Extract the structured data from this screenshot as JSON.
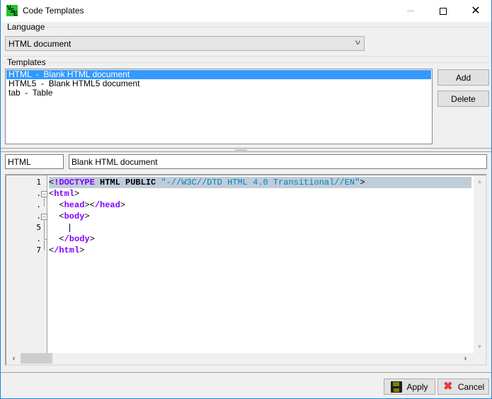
{
  "window": {
    "title": "Code Templates",
    "controls": {
      "minimize": "—",
      "maximize": "☐",
      "close": "✕"
    }
  },
  "language": {
    "group_label": "Language",
    "selected": "HTML document"
  },
  "templates": {
    "group_label": "Templates",
    "items": [
      {
        "label": "HTML  -  Blank HTML document",
        "selected": true
      },
      {
        "label": "HTML5  -  Blank HTML5 document",
        "selected": false
      },
      {
        "label": "tab  -  Table",
        "selected": false
      }
    ],
    "add_label": "Add",
    "delete_label": "Delete"
  },
  "splitter": {
    "grip": "▪▪▪▪▪▪▪▪"
  },
  "fields": {
    "name": "HTML",
    "description": "Blank HTML document"
  },
  "editor": {
    "line_numbers": [
      "1",
      ".",
      ".",
      ".",
      "5",
      ".",
      "7"
    ],
    "lines": [
      [
        {
          "t": "<",
          "c": "tag"
        },
        {
          "t": "!DOCTYPE",
          "c": "kw"
        },
        {
          "t": " ",
          "c": "tag"
        },
        {
          "t": "HTML",
          "c": "bold"
        },
        {
          "t": " ",
          "c": "tag"
        },
        {
          "t": "PUBLIC",
          "c": "bold"
        },
        {
          "t": " ",
          "c": "tag"
        },
        {
          "t": "\"-//W3C//DTD HTML 4.0 Transitional//EN\"",
          "c": "str"
        },
        {
          "t": ">",
          "c": "tag"
        }
      ],
      [
        {
          "t": "<",
          "c": "tag"
        },
        {
          "t": "html",
          "c": "tagn"
        },
        {
          "t": ">",
          "c": "tag"
        }
      ],
      [
        {
          "t": "  <",
          "c": "tag"
        },
        {
          "t": "head",
          "c": "tagn"
        },
        {
          "t": "><",
          "c": "tag"
        },
        {
          "t": "/head",
          "c": "tagn"
        },
        {
          "t": ">",
          "c": "tag"
        }
      ],
      [
        {
          "t": "  <",
          "c": "tag"
        },
        {
          "t": "body",
          "c": "tagn"
        },
        {
          "t": ">",
          "c": "tag"
        }
      ],
      [
        {
          "t": "    ",
          "c": "tag"
        },
        {
          "t": "|",
          "c": "caret"
        }
      ],
      [
        {
          "t": "  <",
          "c": "tag"
        },
        {
          "t": "/body",
          "c": "tagn"
        },
        {
          "t": ">",
          "c": "tag"
        }
      ],
      [
        {
          "t": "<",
          "c": "tag"
        },
        {
          "t": "/html",
          "c": "tagn"
        },
        {
          "t": ">",
          "c": "tag"
        }
      ]
    ],
    "highlighted_line": 1
  },
  "footer": {
    "apply_label": "Apply",
    "cancel_label": "Cancel"
  },
  "colors": {
    "selection": "#3399ff",
    "line_highlight": "#c0cdd9",
    "keyword": "#8000ff",
    "string": "#0080c0"
  }
}
